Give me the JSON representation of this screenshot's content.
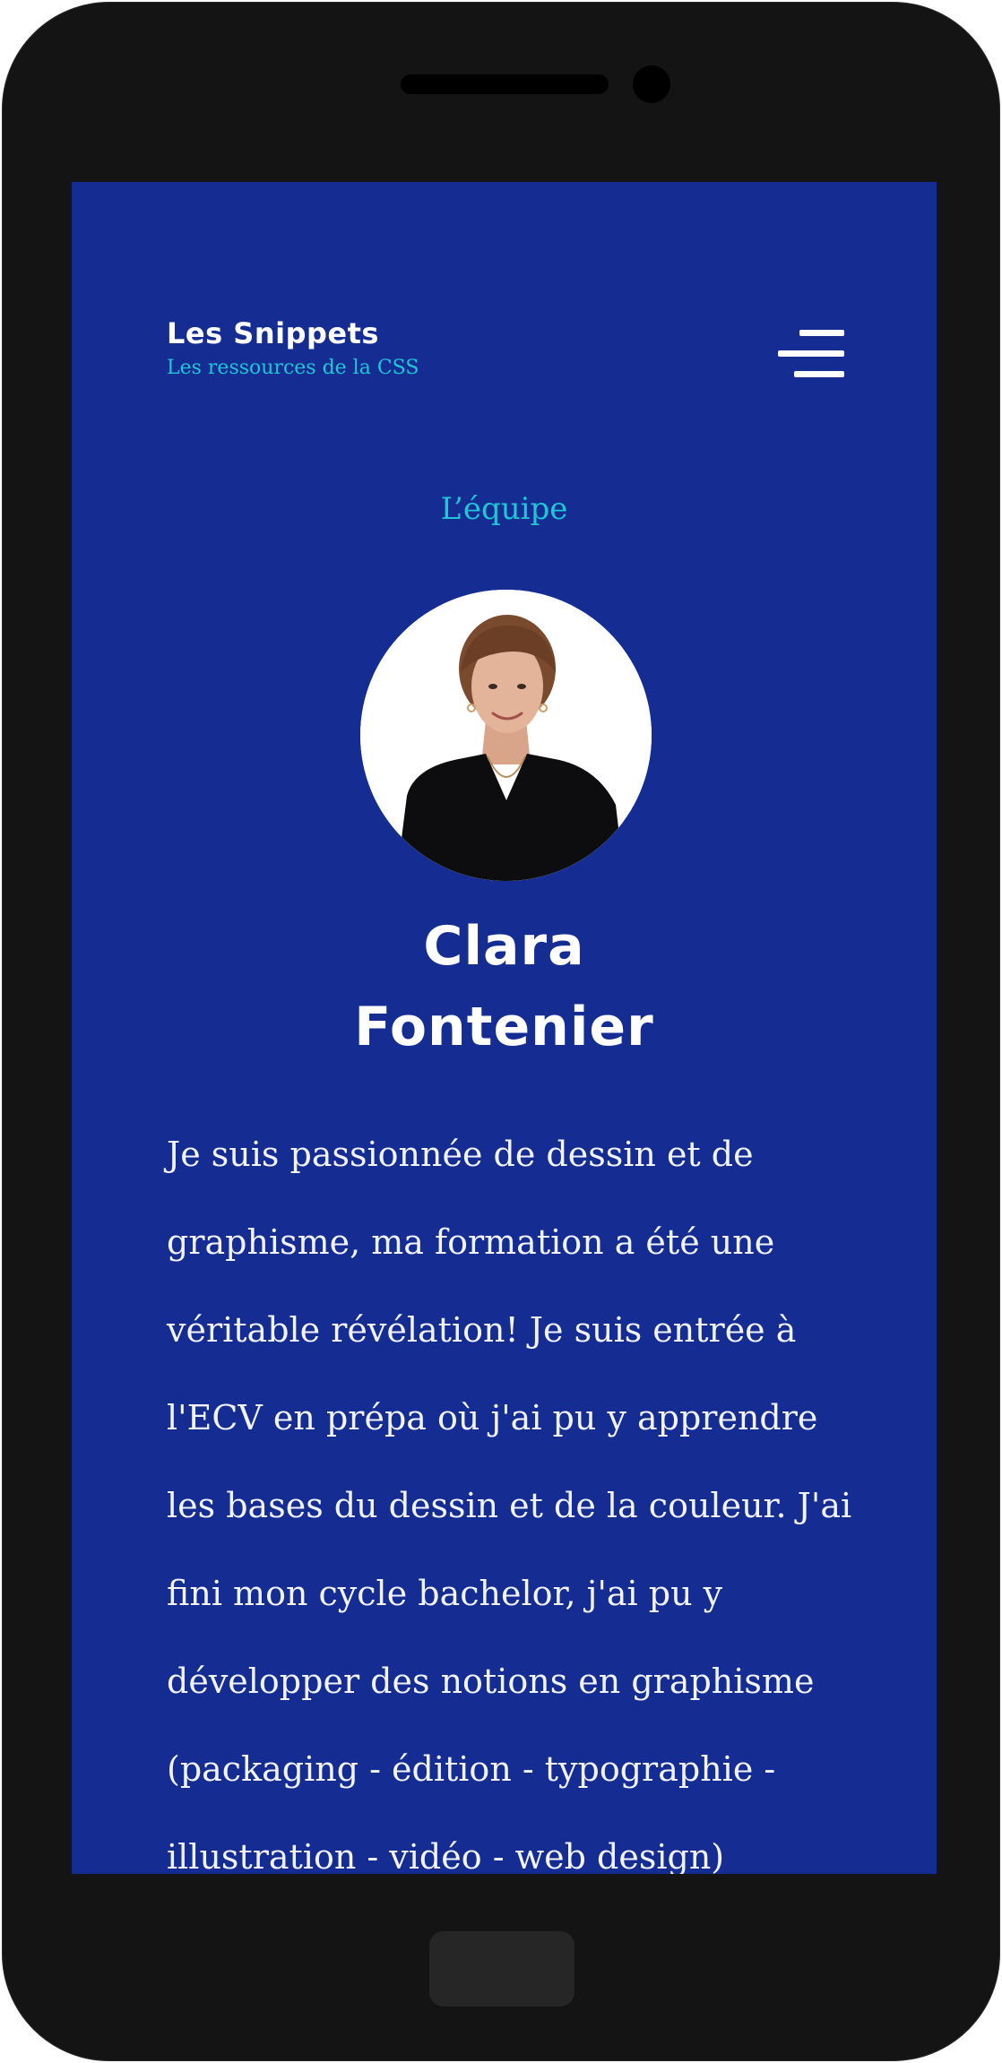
{
  "header": {
    "brand_title": "Les Snippets",
    "brand_subtitle": "Les ressources de la CSS",
    "menu_icon": "hamburger-menu-icon"
  },
  "main": {
    "section_label": "L’équipe",
    "member": {
      "photo": "portrait-photo",
      "name_line1": "Clara",
      "name_line2": "Fontenier",
      "bio": "Je suis passionnée de dessin et de graphisme, ma formation a été une véritable révélation! Je suis entrée à l'ECV en prépa où j'ai pu y apprendre les bases du dessin et de la couleur. J'ai fini mon cycle bachelor, j'ai pu y développer des notions en graphisme (packaging - édition - typographie - illustration - vidéo - web design)"
    }
  },
  "colors": {
    "background": "#152d93",
    "accent": "#1fc6d4",
    "text": "#ffffff",
    "device": "#141414"
  }
}
